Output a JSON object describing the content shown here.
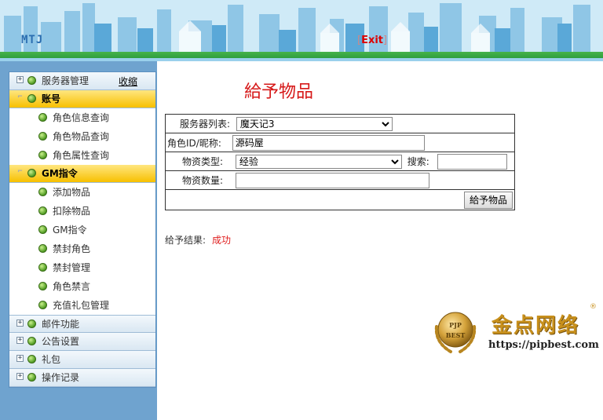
{
  "header": {
    "brand": "MTJ",
    "exit_label": "Exit",
    "exit_open": "[",
    "exit_close": "]"
  },
  "sidebar": {
    "collapse_label": "收缩",
    "groups": [
      {
        "label": "服务器管理",
        "expanded": false,
        "items": []
      },
      {
        "label": "账号",
        "expanded": true,
        "items": [
          "角色信息查询",
          "角色物品查询",
          "角色属性查询"
        ]
      },
      {
        "label": "GM指令",
        "expanded": true,
        "items": [
          "添加物品",
          "扣除物品",
          "GM指令",
          "禁封角色",
          "禁封管理",
          "角色禁言",
          "充值礼包管理"
        ]
      },
      {
        "label": "邮件功能",
        "expanded": false,
        "items": []
      },
      {
        "label": "公告设置",
        "expanded": false,
        "items": []
      },
      {
        "label": "礼包",
        "expanded": false,
        "items": []
      },
      {
        "label": "操作记录",
        "expanded": false,
        "items": []
      }
    ]
  },
  "main": {
    "title": "給予物品",
    "form": {
      "server_label": "服务器列表:",
      "server_value": "魔天记3",
      "role_label": "角色ID/昵称:",
      "role_value": "源码屋",
      "type_label": "物资类型:",
      "type_value": "经验",
      "search_label": "搜索:",
      "search_value": "",
      "qty_label": "物资数量:",
      "qty_value": "",
      "submit_label": "給予物品"
    },
    "result_label": "给予结果:",
    "result_value": "成功"
  },
  "logo": {
    "cn": "金点网络",
    "url": "https://pipbest.com",
    "reg": "®",
    "badge_top": "PJP",
    "badge_bottom": "BEST"
  },
  "colors": {
    "accent": "#d61818",
    "sidebar_bg": "#6fa3cf",
    "active_group": "#f7c000",
    "stripe": "#46b34a"
  }
}
